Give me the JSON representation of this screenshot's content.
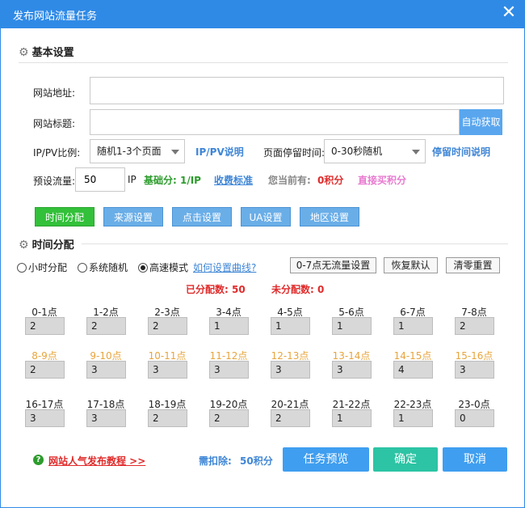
{
  "window": {
    "title": "发布网站流量任务",
    "close_symbol": "✕"
  },
  "basic": {
    "heading": "基本设置",
    "url_label": "网站地址:",
    "url_value": "",
    "title_label": "网站标题:",
    "title_value": "",
    "auto_fetch": "自动获取",
    "ratio_label": "IP/PV比例:",
    "ratio_value": "随机1-3个页面",
    "ratio_help": "IP/PV说明",
    "stay_label": "页面停留时间:",
    "stay_value": "0-30秒随机",
    "stay_help": "停留时间说明",
    "preset_label": "预设流量:",
    "preset_value": "50",
    "ip_unit": "IP",
    "base_score": "基础分: 1/IP",
    "fee_link": "收费标准",
    "current_label": "您当前有:",
    "current_score": "0积分",
    "buy_link": "直接买积分"
  },
  "tabs": [
    "时间分配",
    "来源设置",
    "点击设置",
    "UA设置",
    "地区设置"
  ],
  "time": {
    "heading": "时间分配",
    "radio_hour": "小时分配",
    "radio_random": "系统随机",
    "radio_fast": "高速模式",
    "curve_link": "如何设置曲线?",
    "btn_no_flow": "0-7点无流量设置",
    "btn_restore": "恢复默认",
    "btn_clear": "清零重置",
    "assigned_label": "已分配数:",
    "assigned_value": "50",
    "unassigned_label": "未分配数:",
    "unassigned_value": "0",
    "hours": [
      {
        "label": "0-1点",
        "value": "2"
      },
      {
        "label": "1-2点",
        "value": "2"
      },
      {
        "label": "2-3点",
        "value": "2"
      },
      {
        "label": "3-4点",
        "value": "1"
      },
      {
        "label": "4-5点",
        "value": "1"
      },
      {
        "label": "5-6点",
        "value": "1"
      },
      {
        "label": "6-7点",
        "value": "1"
      },
      {
        "label": "7-8点",
        "value": "2"
      },
      {
        "label": "8-9点",
        "value": "2"
      },
      {
        "label": "9-10点",
        "value": "3"
      },
      {
        "label": "10-11点",
        "value": "3"
      },
      {
        "label": "11-12点",
        "value": "3"
      },
      {
        "label": "12-13点",
        "value": "3"
      },
      {
        "label": "13-14点",
        "value": "3"
      },
      {
        "label": "14-15点",
        "value": "4"
      },
      {
        "label": "15-16点",
        "value": "3"
      },
      {
        "label": "16-17点",
        "value": "3"
      },
      {
        "label": "17-18点",
        "value": "3"
      },
      {
        "label": "18-19点",
        "value": "2"
      },
      {
        "label": "19-20点",
        "value": "2"
      },
      {
        "label": "20-21点",
        "value": "2"
      },
      {
        "label": "21-22点",
        "value": "1"
      },
      {
        "label": "22-23点",
        "value": "1"
      },
      {
        "label": "23-0点",
        "value": "0"
      }
    ]
  },
  "footer": {
    "tutorial": "网站人气发布教程 >>",
    "deduct_label": "需扣除:",
    "deduct_value": "50积分",
    "preview": "任务预览",
    "confirm": "确定",
    "cancel": "取消"
  },
  "colors": {
    "title_bar": "#2f8ae6",
    "blue_button": "#59a6ee",
    "green_tab": "#33c03a",
    "orange_hours": "#e8a43c",
    "red": "#e02b2b",
    "teal": "#2cc4a4",
    "green_text": "#2c9c2c",
    "pink": "#e87ad0"
  }
}
